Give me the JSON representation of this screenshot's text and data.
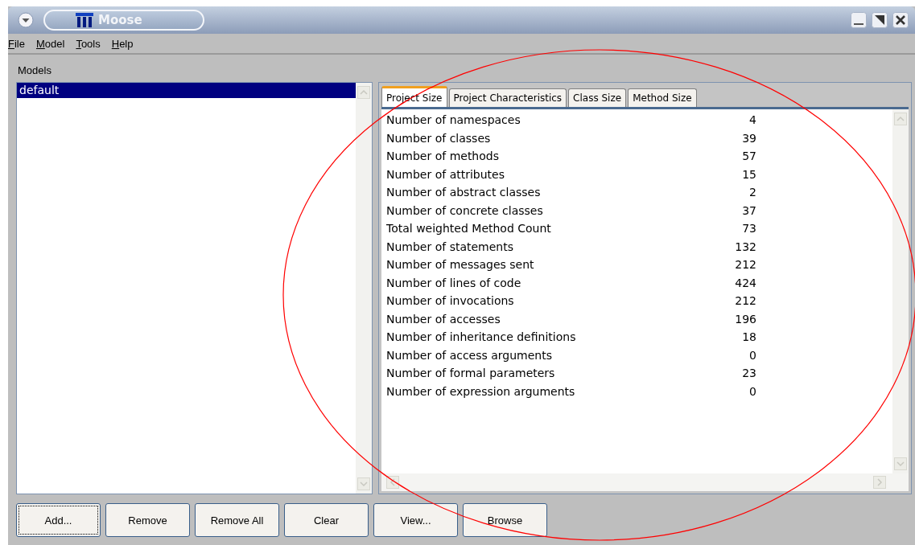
{
  "window": {
    "title": "Moose"
  },
  "menu": [
    "File",
    "Model",
    "Tools",
    "Help"
  ],
  "models": {
    "label": "Models",
    "items": [
      {
        "name": "default",
        "selected": true
      }
    ]
  },
  "tabs": [
    {
      "label": "Project Size",
      "selected": true
    },
    {
      "label": "Project Characteristics",
      "selected": false
    },
    {
      "label": "Class Size",
      "selected": false
    },
    {
      "label": "Method Size",
      "selected": false
    }
  ],
  "metrics": [
    {
      "name": "Number of namespaces",
      "value": "4"
    },
    {
      "name": "Number of classes",
      "value": "39"
    },
    {
      "name": "Number of methods",
      "value": "57"
    },
    {
      "name": "Number of attributes",
      "value": "15"
    },
    {
      "name": "Number of abstract classes",
      "value": "2"
    },
    {
      "name": "Number of concrete classes",
      "value": "37"
    },
    {
      "name": "Total weighted Method Count",
      "value": "73"
    },
    {
      "name": "Number of statements",
      "value": "132"
    },
    {
      "name": "Number of messages sent",
      "value": "212"
    },
    {
      "name": "Number of lines of code",
      "value": "424"
    },
    {
      "name": "Number of invocations",
      "value": "212"
    },
    {
      "name": "Number of accesses",
      "value": "196"
    },
    {
      "name": "Number of inheritance definitions",
      "value": "18"
    },
    {
      "name": "Number of access arguments",
      "value": "0"
    },
    {
      "name": "Number of formal parameters",
      "value": "23"
    },
    {
      "name": "Number of expression arguments",
      "value": "0"
    }
  ],
  "buttons": [
    {
      "label": "Add...",
      "focused": true
    },
    {
      "label": "Remove",
      "focused": false
    },
    {
      "label": "Remove All",
      "focused": false
    },
    {
      "label": "Clear",
      "focused": false
    },
    {
      "label": "View...",
      "focused": false
    },
    {
      "label": "Browse",
      "focused": false
    }
  ]
}
